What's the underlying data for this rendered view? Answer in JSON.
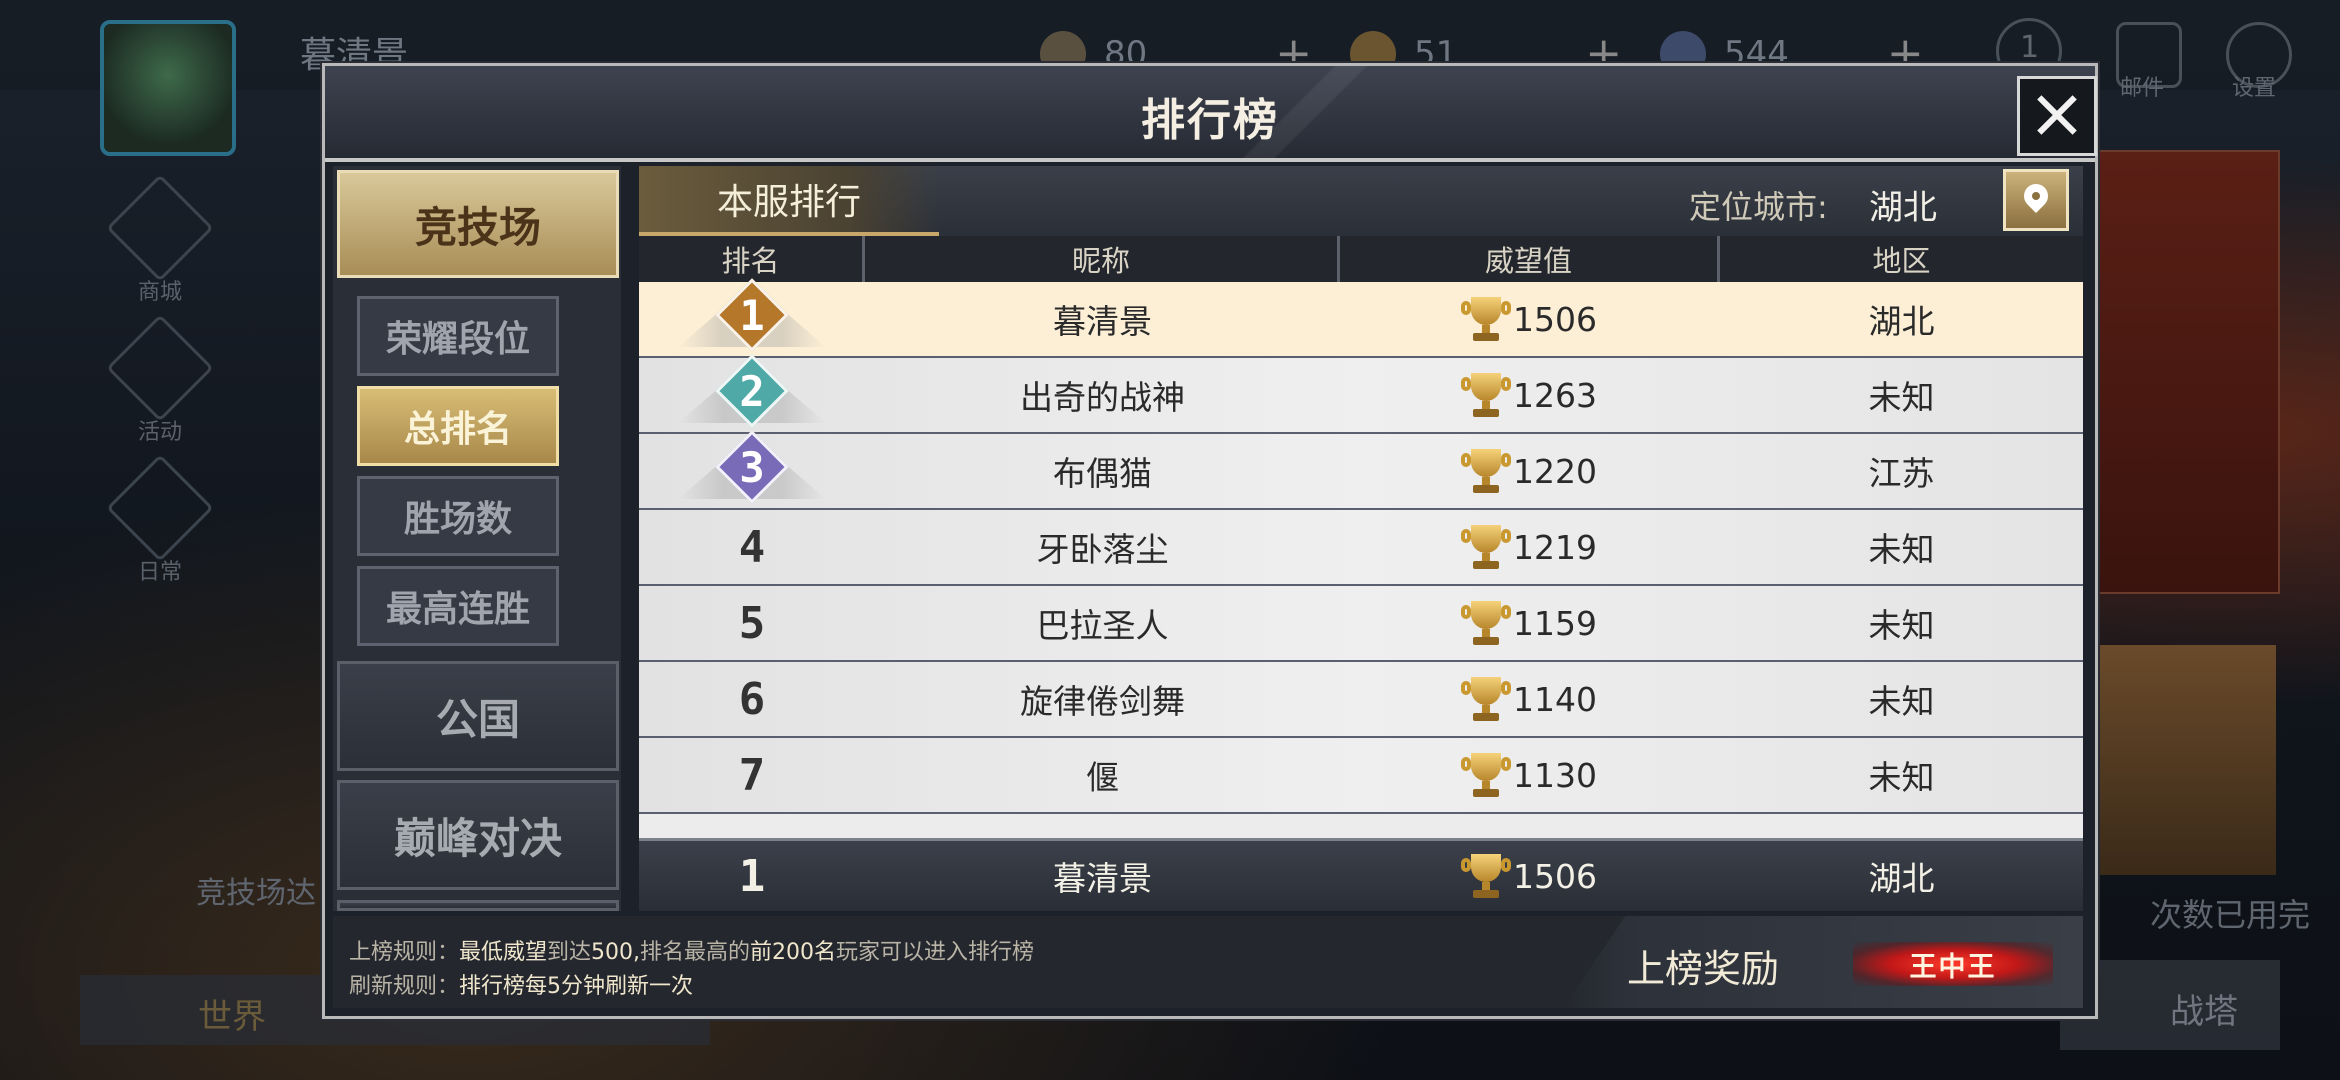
{
  "background": {
    "player_name": "暮清景",
    "resources": [
      {
        "value": "80"
      },
      {
        "value": "51"
      },
      {
        "value": "544"
      }
    ],
    "left_nav": [
      "商城",
      "活动",
      "日常"
    ],
    "top_right": {
      "mail": "邮件",
      "settings": "设置",
      "badge": "1"
    },
    "bottom_chat_channel": "世界",
    "bottom_right_button": "战塔",
    "arena_hint": "竞技场达",
    "times_used": "次数已用完"
  },
  "modal": {
    "title": "排行榜",
    "side_main_tabs": [
      {
        "label": "竞技场",
        "active": true
      },
      {
        "label": "公国",
        "active": false
      },
      {
        "label": "巅峰对决",
        "active": false
      }
    ],
    "sub_tabs": [
      {
        "label": "荣耀段位",
        "active": false
      },
      {
        "label": "总排名",
        "active": true
      },
      {
        "label": "胜场数",
        "active": false
      },
      {
        "label": "最高连胜",
        "active": false
      }
    ],
    "server_tab": "本服排行",
    "city_label": "定位城市:",
    "city_value": "湖北",
    "columns": [
      "排名",
      "昵称",
      "威望值",
      "地区"
    ],
    "rows": [
      {
        "rank": "1",
        "name": "暮清景",
        "score": "1506",
        "region": "湖北"
      },
      {
        "rank": "2",
        "name": "出奇的战神",
        "score": "1263",
        "region": "未知"
      },
      {
        "rank": "3",
        "name": "布偶猫",
        "score": "1220",
        "region": "江苏"
      },
      {
        "rank": "4",
        "name": "牙卧落尘",
        "score": "1219",
        "region": "未知"
      },
      {
        "rank": "5",
        "name": "巴拉圣人",
        "score": "1159",
        "region": "未知"
      },
      {
        "rank": "6",
        "name": "旋律倦剑舞",
        "score": "1140",
        "region": "未知"
      },
      {
        "rank": "7",
        "name": "偃",
        "score": "1130",
        "region": "未知"
      }
    ],
    "self_row": {
      "rank": "1",
      "name": "暮清景",
      "score": "1506",
      "region": "湖北"
    },
    "rules": {
      "line1_label": "上榜规则：",
      "line1_a": "最低威望",
      "line1_b": "到达",
      "line1_c": "500,",
      "line1_d": "排名最高的",
      "line1_e": "前200名",
      "line1_f": "玩家可以进入排行榜",
      "line2_label": "刷新规则：",
      "line2_text": "排行榜每5分钟刷新一次"
    },
    "reward_label": "上榜奖励",
    "reward_badge": "王中王"
  },
  "colors": {
    "medal_gold": "#b5772a",
    "medal_teal": "#4fa9a6",
    "medal_purple": "#7a6bb8",
    "accent_gold": "#c8a86a"
  }
}
